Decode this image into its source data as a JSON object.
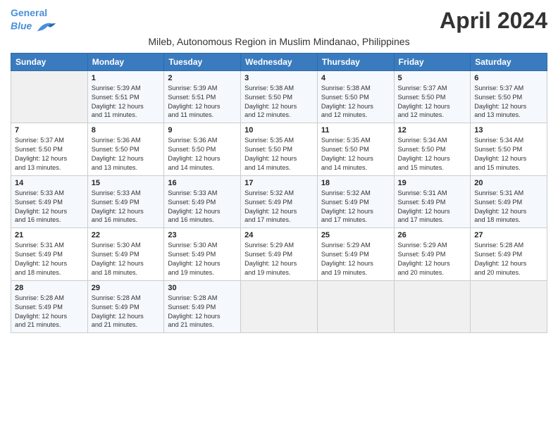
{
  "header": {
    "logo_line1": "General",
    "logo_line2": "Blue",
    "title": "April 2024",
    "subtitle": "Mileb, Autonomous Region in Muslim Mindanao, Philippines"
  },
  "days_of_week": [
    "Sunday",
    "Monday",
    "Tuesday",
    "Wednesday",
    "Thursday",
    "Friday",
    "Saturday"
  ],
  "weeks": [
    [
      {
        "day": "",
        "info": ""
      },
      {
        "day": "1",
        "info": "Sunrise: 5:39 AM\nSunset: 5:51 PM\nDaylight: 12 hours\nand 11 minutes."
      },
      {
        "day": "2",
        "info": "Sunrise: 5:39 AM\nSunset: 5:51 PM\nDaylight: 12 hours\nand 11 minutes."
      },
      {
        "day": "3",
        "info": "Sunrise: 5:38 AM\nSunset: 5:50 PM\nDaylight: 12 hours\nand 12 minutes."
      },
      {
        "day": "4",
        "info": "Sunrise: 5:38 AM\nSunset: 5:50 PM\nDaylight: 12 hours\nand 12 minutes."
      },
      {
        "day": "5",
        "info": "Sunrise: 5:37 AM\nSunset: 5:50 PM\nDaylight: 12 hours\nand 12 minutes."
      },
      {
        "day": "6",
        "info": "Sunrise: 5:37 AM\nSunset: 5:50 PM\nDaylight: 12 hours\nand 13 minutes."
      }
    ],
    [
      {
        "day": "7",
        "info": "Sunrise: 5:37 AM\nSunset: 5:50 PM\nDaylight: 12 hours\nand 13 minutes."
      },
      {
        "day": "8",
        "info": "Sunrise: 5:36 AM\nSunset: 5:50 PM\nDaylight: 12 hours\nand 13 minutes."
      },
      {
        "day": "9",
        "info": "Sunrise: 5:36 AM\nSunset: 5:50 PM\nDaylight: 12 hours\nand 14 minutes."
      },
      {
        "day": "10",
        "info": "Sunrise: 5:35 AM\nSunset: 5:50 PM\nDaylight: 12 hours\nand 14 minutes."
      },
      {
        "day": "11",
        "info": "Sunrise: 5:35 AM\nSunset: 5:50 PM\nDaylight: 12 hours\nand 14 minutes."
      },
      {
        "day": "12",
        "info": "Sunrise: 5:34 AM\nSunset: 5:50 PM\nDaylight: 12 hours\nand 15 minutes."
      },
      {
        "day": "13",
        "info": "Sunrise: 5:34 AM\nSunset: 5:50 PM\nDaylight: 12 hours\nand 15 minutes."
      }
    ],
    [
      {
        "day": "14",
        "info": "Sunrise: 5:33 AM\nSunset: 5:49 PM\nDaylight: 12 hours\nand 16 minutes."
      },
      {
        "day": "15",
        "info": "Sunrise: 5:33 AM\nSunset: 5:49 PM\nDaylight: 12 hours\nand 16 minutes."
      },
      {
        "day": "16",
        "info": "Sunrise: 5:33 AM\nSunset: 5:49 PM\nDaylight: 12 hours\nand 16 minutes."
      },
      {
        "day": "17",
        "info": "Sunrise: 5:32 AM\nSunset: 5:49 PM\nDaylight: 12 hours\nand 17 minutes."
      },
      {
        "day": "18",
        "info": "Sunrise: 5:32 AM\nSunset: 5:49 PM\nDaylight: 12 hours\nand 17 minutes."
      },
      {
        "day": "19",
        "info": "Sunrise: 5:31 AM\nSunset: 5:49 PM\nDaylight: 12 hours\nand 17 minutes."
      },
      {
        "day": "20",
        "info": "Sunrise: 5:31 AM\nSunset: 5:49 PM\nDaylight: 12 hours\nand 18 minutes."
      }
    ],
    [
      {
        "day": "21",
        "info": "Sunrise: 5:31 AM\nSunset: 5:49 PM\nDaylight: 12 hours\nand 18 minutes."
      },
      {
        "day": "22",
        "info": "Sunrise: 5:30 AM\nSunset: 5:49 PM\nDaylight: 12 hours\nand 18 minutes."
      },
      {
        "day": "23",
        "info": "Sunrise: 5:30 AM\nSunset: 5:49 PM\nDaylight: 12 hours\nand 19 minutes."
      },
      {
        "day": "24",
        "info": "Sunrise: 5:29 AM\nSunset: 5:49 PM\nDaylight: 12 hours\nand 19 minutes."
      },
      {
        "day": "25",
        "info": "Sunrise: 5:29 AM\nSunset: 5:49 PM\nDaylight: 12 hours\nand 19 minutes."
      },
      {
        "day": "26",
        "info": "Sunrise: 5:29 AM\nSunset: 5:49 PM\nDaylight: 12 hours\nand 20 minutes."
      },
      {
        "day": "27",
        "info": "Sunrise: 5:28 AM\nSunset: 5:49 PM\nDaylight: 12 hours\nand 20 minutes."
      }
    ],
    [
      {
        "day": "28",
        "info": "Sunrise: 5:28 AM\nSunset: 5:49 PM\nDaylight: 12 hours\nand 21 minutes."
      },
      {
        "day": "29",
        "info": "Sunrise: 5:28 AM\nSunset: 5:49 PM\nDaylight: 12 hours\nand 21 minutes."
      },
      {
        "day": "30",
        "info": "Sunrise: 5:28 AM\nSunset: 5:49 PM\nDaylight: 12 hours\nand 21 minutes."
      },
      {
        "day": "",
        "info": ""
      },
      {
        "day": "",
        "info": ""
      },
      {
        "day": "",
        "info": ""
      },
      {
        "day": "",
        "info": ""
      }
    ]
  ]
}
